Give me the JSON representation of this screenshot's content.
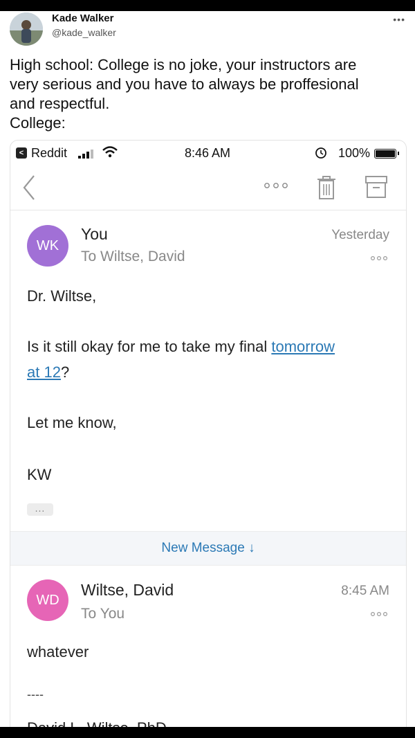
{
  "tweet": {
    "author_name": "Kade Walker",
    "author_handle": "@kade_walker",
    "more_icon": "more-horizontal-icon",
    "text_lines": [
      "High school: College is no joke, your instructors are",
      "very serious and you have to always be proffesional",
      "and respectful.",
      "College:"
    ]
  },
  "status_bar": {
    "app_back_label": "Reddit",
    "time": "8:46 AM",
    "battery": "100%",
    "icons": [
      "signal-icon",
      "wifi-icon",
      "alarm-icon",
      "battery-icon"
    ]
  },
  "toolbar": {
    "icons": [
      "back-chevron-icon",
      "more-icon",
      "trash-icon",
      "archive-icon"
    ]
  },
  "messages": [
    {
      "avatar_initials": "WK",
      "avatar_color": "#a170d6",
      "from": "You",
      "to": "To Wiltse, David",
      "time": "Yesterday",
      "greeting": "Dr. Wiltse,",
      "line1_prefix": "Is it still okay for me to take my final ",
      "line1_link": "tomorrow",
      "line2_link": "at 12",
      "line2_suffix": "?",
      "closing": "Let me know,",
      "signature": "KW",
      "expand_label": "..."
    },
    {
      "avatar_initials": "WD",
      "avatar_color": "#e665b6",
      "from": "Wiltse, David",
      "to": "To You",
      "time": "8:45 AM",
      "body": "whatever",
      "separator": "----",
      "signature": "David L. Wiltse, PhD"
    }
  ],
  "new_message_label": "New Message ↓",
  "colors": {
    "link": "#2b79b5",
    "banner_bg": "#f4f6f9"
  }
}
